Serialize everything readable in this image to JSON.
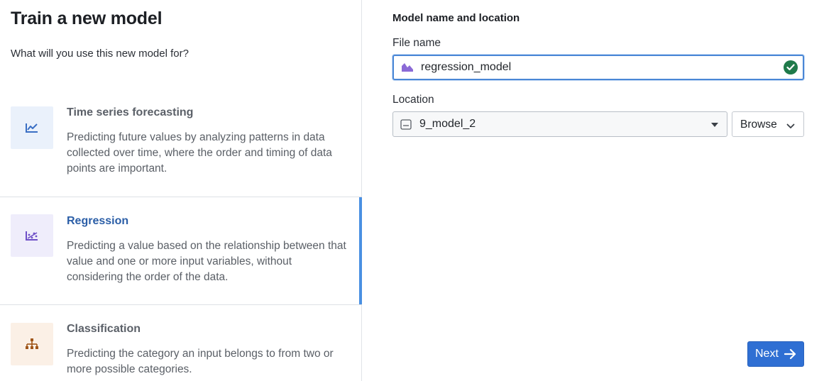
{
  "dialog": {
    "title": "Train a new model",
    "subtitle": "What will you use this new model for?"
  },
  "options": [
    {
      "title": "Time series forecasting",
      "description": "Predicting future values by analyzing patterns in data collected over time, where the order and timing of data points are important.",
      "icon": "line-chart-icon",
      "icon_bg": "#eaf1fb",
      "icon_color": "#3a6fc4",
      "selected": false
    },
    {
      "title": "Regression",
      "description": "Predicting a value based on the relationship between that value and one or more input variables, without considering the order of the data.",
      "icon": "scatter-trend-icon",
      "icon_bg": "#efedfb",
      "icon_color": "#6e4fc7",
      "selected": true
    },
    {
      "title": "Classification",
      "description": "Predicting the category an input belongs to from two or more possible categories.",
      "icon": "hierarchy-icon",
      "icon_bg": "#fbf0e6",
      "icon_color": "#a0561a",
      "selected": false
    }
  ],
  "form": {
    "section_title": "Model name and location",
    "file_name_label": "File name",
    "file_name_value": "regression_model",
    "location_label": "Location",
    "location_value": "9_model_2",
    "browse_label": "Browse",
    "next_label": "Next"
  },
  "colors": {
    "accent": "#4a90e2",
    "primary_button": "#2f6fd3",
    "valid_check": "#1f7a4a",
    "model_icon": "#8b6ad6"
  }
}
